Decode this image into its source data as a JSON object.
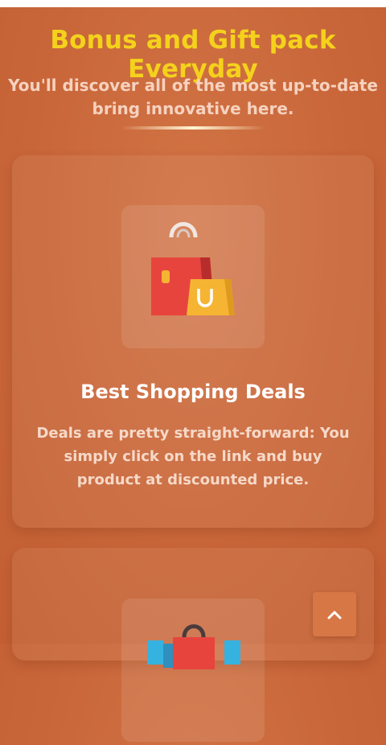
{
  "header": {
    "title": "Bonus and Gift pack Everyday",
    "subtitle": "You'll discover all of the most up-to-date bring innovative here."
  },
  "features": [
    {
      "icon": "shopping-bags-icon",
      "title": "Best Shopping Deals",
      "description": "Deals are pretty straight-forward: You simply click on the link and buy product at discounted price."
    },
    {
      "icon": "shopping-bag-icon"
    }
  ],
  "scroll_top_button": {
    "icon": "chevron-up-icon"
  },
  "colors": {
    "background": "#c9673a",
    "headline": "#f4d21c",
    "card_title": "#ffffff",
    "bag_red": "#e8443e",
    "bag_yellow": "#f5b533"
  }
}
